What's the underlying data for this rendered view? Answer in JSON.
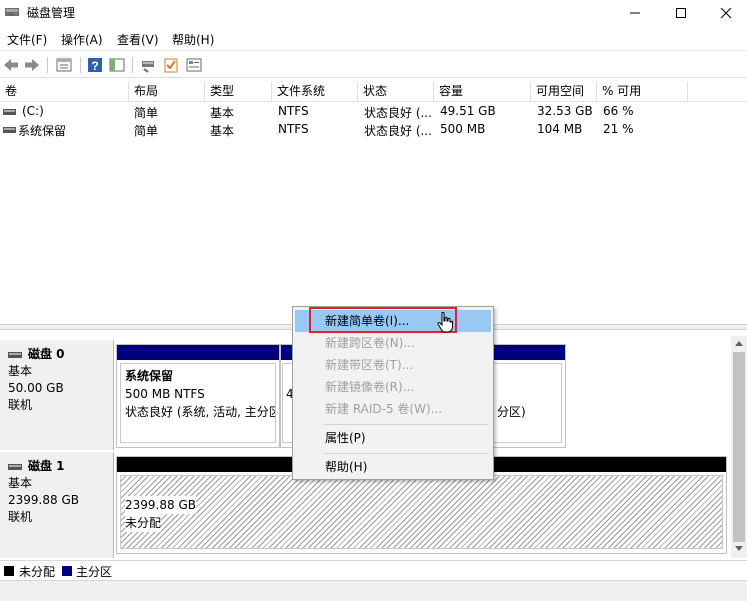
{
  "window": {
    "title": "磁盘管理",
    "minimize_icon": "minimize-icon",
    "maximize_icon": "maximize-icon",
    "close_icon": "close-icon"
  },
  "menu": [
    "文件(F)",
    "操作(A)",
    "查看(V)",
    "帮助(H)"
  ],
  "toolbar": [
    "back-arrow-icon",
    "forward-arrow-icon",
    "properties-icon",
    "help-icon",
    "console-tree-icon",
    "connect-icon",
    "check-icon",
    "properties-sheet-icon"
  ],
  "columns": [
    "卷",
    "布局",
    "类型",
    "文件系统",
    "状态",
    "容量",
    "可用空间",
    "% 可用"
  ],
  "volumes": [
    {
      "name": "(C:)",
      "layout": "简单",
      "type": "基本",
      "fs": "NTFS",
      "status": "状态良好 (...",
      "capacity": "49.51 GB",
      "free": "32.53 GB",
      "pct": "66 %"
    },
    {
      "name": "系统保留",
      "layout": "简单",
      "type": "基本",
      "fs": "NTFS",
      "status": "状态良好 (...",
      "capacity": "500 MB",
      "free": "104 MB",
      "pct": "21 %"
    }
  ],
  "disks": [
    {
      "name": "磁盘 0",
      "type": "基本",
      "size": "50.00 GB",
      "state": "联机",
      "partitions": [
        {
          "title": "系统保留",
          "size": "500 MB NTFS",
          "status": "状态良好 (系统, 活动, 主分区)"
        },
        {
          "title": "",
          "size": "",
          "status": "4"
        },
        {
          "title": "",
          "size": "",
          "status": "分区)"
        }
      ]
    },
    {
      "name": "磁盘 1",
      "type": "基本",
      "size": "2399.88 GB",
      "state": "联机",
      "partitions": [
        {
          "title": "",
          "size": "2399.88 GB",
          "status": "未分配"
        }
      ]
    }
  ],
  "legend": [
    {
      "label": "未分配",
      "color": "#000000"
    },
    {
      "label": "主分区",
      "color": "#00007f"
    }
  ],
  "context_menu": {
    "items": [
      {
        "label": "新建简单卷(I)...",
        "enabled": true,
        "highlighted": true
      },
      {
        "label": "新建跨区卷(N)...",
        "enabled": false
      },
      {
        "label": "新建带区卷(T)...",
        "enabled": false
      },
      {
        "label": "新建镜像卷(R)...",
        "enabled": false
      },
      {
        "label": "新建 RAID-5 卷(W)...",
        "enabled": false
      },
      {
        "label": "属性(P)",
        "enabled": true
      },
      {
        "label": "帮助(H)",
        "enabled": true
      }
    ]
  },
  "colors": {
    "primary_partition": "#00007f",
    "unallocated": "#000000",
    "menu_highlight": "#99c9f3",
    "callout": "#d9262b"
  }
}
